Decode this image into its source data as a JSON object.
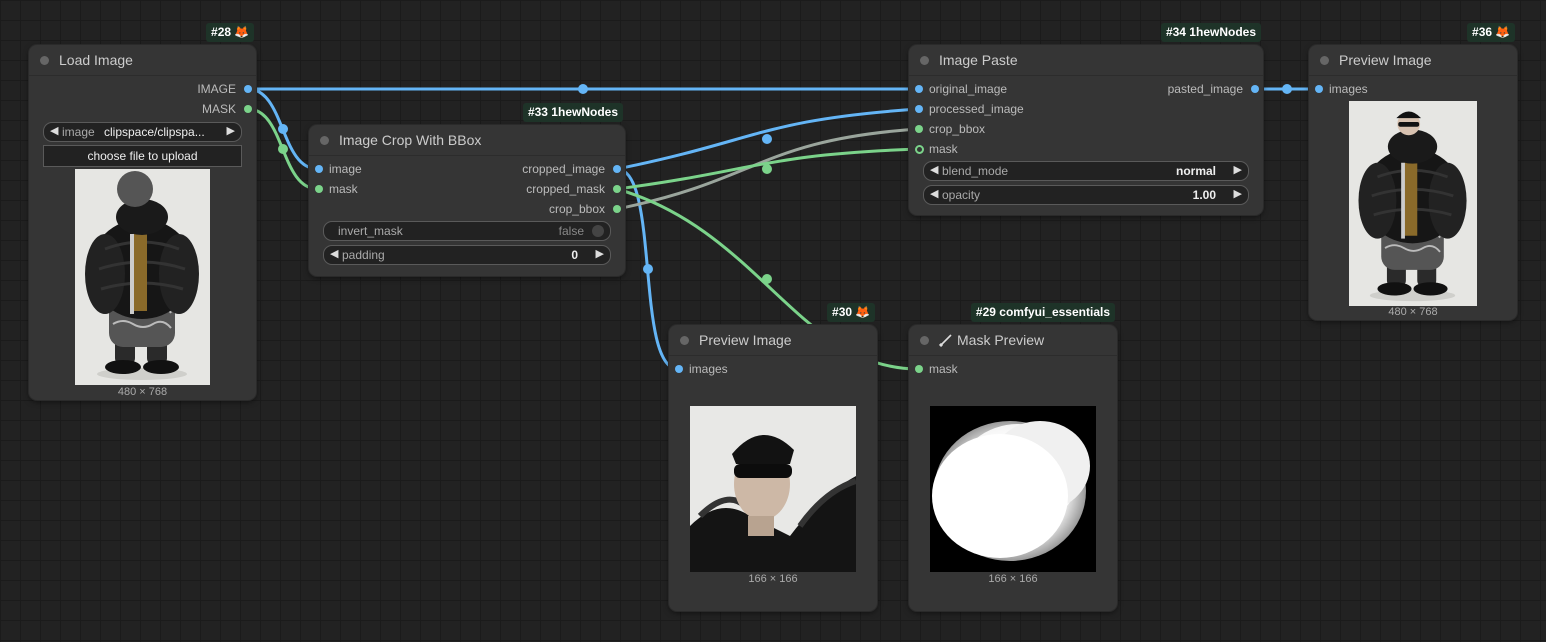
{
  "nodes": {
    "load_image": {
      "badge": "#28",
      "title": "Load Image",
      "outputs": [
        "IMAGE",
        "MASK"
      ],
      "image_widget": {
        "label": "image",
        "value": "clipspace/clipspa..."
      },
      "upload_label": "choose file to upload",
      "size": "480 × 768"
    },
    "crop": {
      "badge": "#33 1hewNodes",
      "title": "Image Crop With BBox",
      "inputs": [
        "image",
        "mask"
      ],
      "outputs": [
        "cropped_image",
        "cropped_mask",
        "crop_bbox"
      ],
      "invert_mask": {
        "label": "invert_mask",
        "value": "false"
      },
      "padding": {
        "label": "padding",
        "value": "0"
      }
    },
    "paste": {
      "badge": "#34 1hewNodes",
      "title": "Image Paste",
      "inputs": [
        "original_image",
        "processed_image",
        "crop_bbox",
        "mask"
      ],
      "outputs": [
        "pasted_image"
      ],
      "blend_mode": {
        "label": "blend_mode",
        "value": "normal"
      },
      "opacity": {
        "label": "opacity",
        "value": "1.00"
      }
    },
    "preview36": {
      "badge": "#36",
      "title": "Preview Image",
      "inputs": [
        "images"
      ],
      "size": "480 × 768"
    },
    "preview30": {
      "badge": "#30",
      "title": "Preview Image",
      "inputs": [
        "images"
      ],
      "size": "166 × 166"
    },
    "mask_preview": {
      "badge": "#29 comfyui_essentials",
      "title": "Mask Preview",
      "inputs": [
        "mask"
      ],
      "size": "166 × 166"
    }
  },
  "colors": {
    "image_link": "#64b5f6",
    "mask_link": "#7bd38a",
    "bbox_link": "#9aa59c",
    "canvas": "#222222",
    "node": "#353535"
  },
  "icons": {
    "badge_icon": "fox-icon",
    "mask_title_icon": "brush-icon"
  }
}
